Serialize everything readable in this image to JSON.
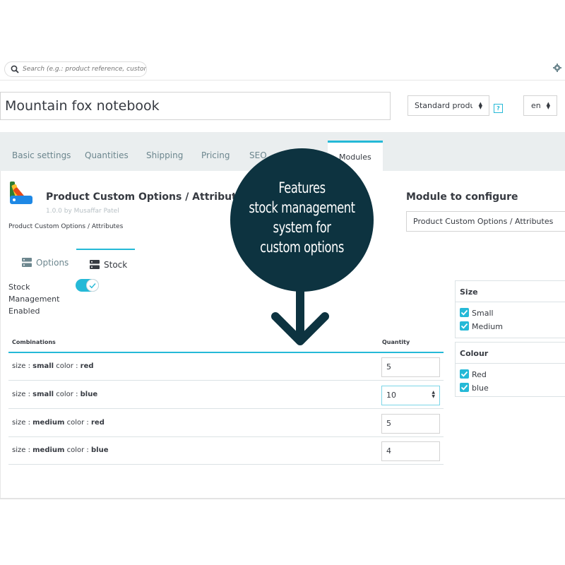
{
  "header": {
    "search_placeholder": "Search (e.g.: product reference, customer name...)",
    "product_name": "Mountain fox notebook",
    "product_type": "Standard product",
    "help_label": "?",
    "language": "en"
  },
  "tabs": [
    {
      "label": "Basic settings"
    },
    {
      "label": "Quantities"
    },
    {
      "label": "Shipping"
    },
    {
      "label": "Pricing"
    },
    {
      "label": "SEO"
    },
    {
      "label": "Modules"
    }
  ],
  "module": {
    "title": "Product Custom Options / Attributes",
    "version": "1.0.0 by Musaffar Patel",
    "caption": "Product Custom Options / Attributes",
    "configure_title": "Module to configure",
    "configure_value": "Product Custom Options / Attributes"
  },
  "subtabs": {
    "options": "Options",
    "stock": "Stock"
  },
  "stock": {
    "label": "Stock Management Enabled",
    "enabled": true
  },
  "table": {
    "col_combinations": "Combinations",
    "col_quantity": "Quantity",
    "rows": [
      {
        "k1": "size : ",
        "v1": "small",
        "k2": " color : ",
        "v2": "red",
        "qty": "5"
      },
      {
        "k1": "size : ",
        "v1": "small",
        "k2": " color : ",
        "v2": "blue",
        "qty": "10"
      },
      {
        "k1": "size : ",
        "v1": "medium",
        "k2": " color : ",
        "v2": "red",
        "qty": "5"
      },
      {
        "k1": "size : ",
        "v1": "medium",
        "k2": " color : ",
        "v2": "blue",
        "qty": "4"
      }
    ]
  },
  "filters": {
    "size": {
      "title": "Size",
      "items": [
        "Small",
        "Medium"
      ]
    },
    "colour": {
      "title": "Colour",
      "items": [
        "Red",
        "blue"
      ]
    }
  },
  "callout": {
    "line1": "Features",
    "line2": "stock management",
    "line3": "system for",
    "line4": "custom options"
  },
  "colors": {
    "accent": "#25b9d7",
    "callout_bg": "#0d3340"
  }
}
